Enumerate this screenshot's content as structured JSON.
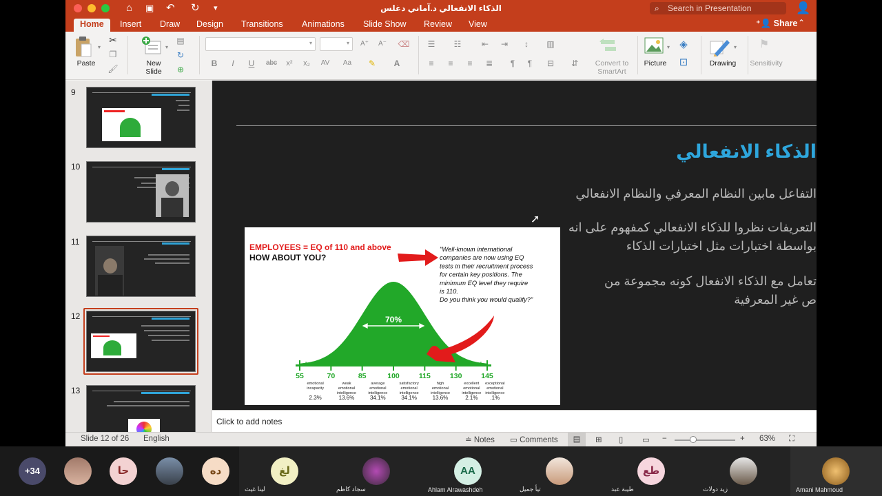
{
  "window": {
    "title": "الذكاء الانفعالي د.آماني دغلس",
    "search_placeholder": "Search in Presentation"
  },
  "colors": {
    "accent": "#c43e1c",
    "slide_title": "#2ea6dc",
    "slide_bg": "#1f1f1f"
  },
  "tabs": [
    "Home",
    "Insert",
    "Draw",
    "Design",
    "Transitions",
    "Animations",
    "Slide Show",
    "Review",
    "View"
  ],
  "share_label": "Share",
  "ribbon": {
    "paste": "Paste",
    "new_slide_l1": "New",
    "new_slide_l2": "Slide",
    "convert_l1": "Convert to",
    "convert_l2": "SmartArt",
    "picture": "Picture",
    "drawing": "Drawing",
    "sensitivity": "Sensitivity",
    "bold": "B",
    "italic": "I",
    "underline": "U",
    "strike": "abc"
  },
  "thumbnails": [
    {
      "num": "9"
    },
    {
      "num": "10"
    },
    {
      "num": "11"
    },
    {
      "num": "12"
    },
    {
      "num": "13"
    }
  ],
  "slide": {
    "title": "الذكاء الانفعالي",
    "bullets": [
      "التفاعل مابين النظام المعرفي والنظام الانفعالي",
      "التعريفات نظروا للذكاء الانفعالي كمفهوم على انه",
      "بواسطة اختبارات مثل اختبارات الذكاء",
      "تعامل مع الذكاء الانفعال كونه مجموعة من",
      "ص غير المعرفية"
    ],
    "image": {
      "headline1": "EMPLOYEES = EQ of 110 and above",
      "headline2": "HOW ABOUT YOU?",
      "quote": [
        "\"Well-known international",
        "companies are now using EQ",
        "tests in their recruitment process",
        "for certain key positions. The",
        "minimum EQ level they require",
        "is 110.",
        "Do you think you would qualify?\""
      ],
      "center_label": "70%"
    }
  },
  "chart_data": {
    "type": "area",
    "title": "EMPLOYEES = EQ of 110 and above",
    "x": [
      55,
      70,
      85,
      100,
      115,
      130,
      145
    ],
    "ticks": [
      "55",
      "70",
      "85",
      "100",
      "115",
      "130",
      "145"
    ],
    "categories": [
      [
        "emotional",
        "incapacity"
      ],
      [
        "weak",
        "emotional",
        "intelligence"
      ],
      [
        "average",
        "emotional",
        "intelligence"
      ],
      [
        "satisfactory",
        "emotional",
        "intelligence"
      ],
      [
        "high",
        "emotional",
        "intelligence"
      ],
      [
        "excellent",
        "emotional",
        "intelligence"
      ],
      [
        "exceptional",
        "emotional",
        "intelligence"
      ]
    ],
    "percentages": [
      "2.3%",
      "13.6%",
      "34.1%",
      "34.1%",
      "13.6%",
      "2.1%",
      ".1%"
    ],
    "annotation": "70%"
  },
  "notes_placeholder": "Click to add notes",
  "status": {
    "slide_info": "Slide 12 of 26",
    "language": "English",
    "notes": "Notes",
    "comments": "Comments",
    "zoom": "63%"
  },
  "participants": [
    {
      "initials": "+34",
      "name": ""
    },
    {
      "initials": "",
      "name": ""
    },
    {
      "initials": "حا",
      "name": ""
    },
    {
      "initials": "",
      "name": ""
    },
    {
      "initials": "ده",
      "name": ""
    },
    {
      "initials": "لغ",
      "name": "لينا غيث"
    },
    {
      "initials": "",
      "name": "سجاد كاظم"
    },
    {
      "initials": "AA",
      "name": "Ahlam Alrawashdeh"
    },
    {
      "initials": "",
      "name": "تيأ جميل"
    },
    {
      "initials": "طع",
      "name": "طيبة عبد"
    },
    {
      "initials": "",
      "name": "زيد دولات"
    },
    {
      "initials": "",
      "name": "Amani Mahmoud"
    }
  ]
}
